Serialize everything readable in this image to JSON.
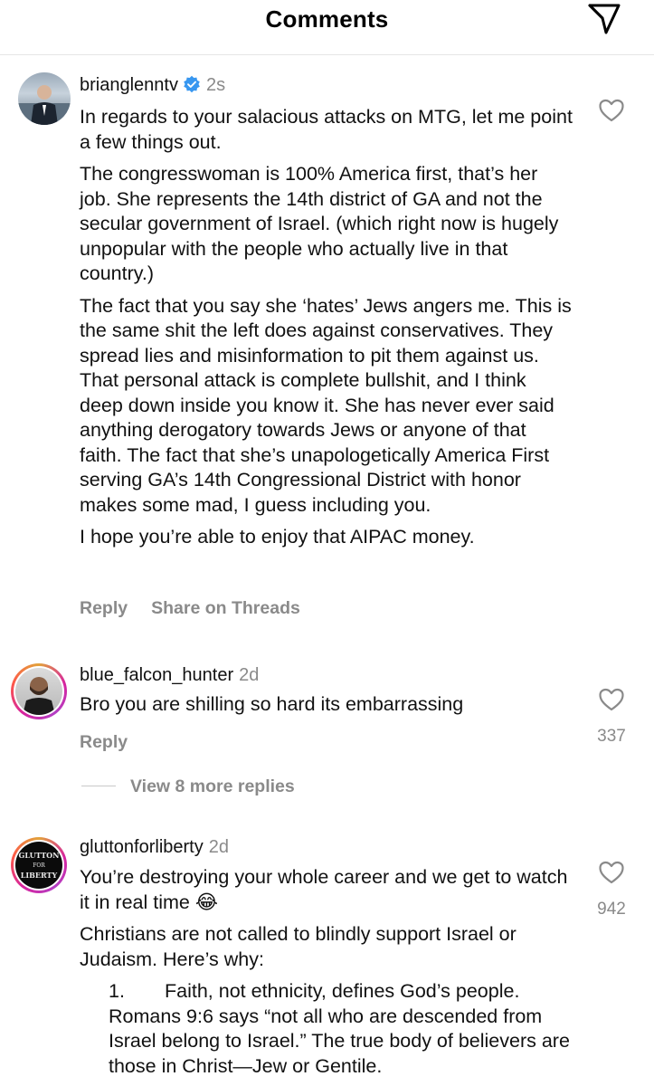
{
  "header": {
    "title": "Comments",
    "send_icon": "send-paper-plane-icon"
  },
  "colors": {
    "secondary_text": "#8a8a8a",
    "verified_blue": "#3897f0",
    "ring_gradient": [
      "#e2a23a",
      "#d6249f",
      "#b33fc4"
    ]
  },
  "comments": [
    {
      "username": "brianglenntv",
      "verified": true,
      "time": "2s",
      "paragraphs": [
        "In regards to your salacious attacks on MTG, let me point a few things out.",
        "The congresswoman is 100% America first, that’s her job. She represents the 14th district of GA and not the secular government of Israel. (which right now is hugely unpopular with the people who actually live in that country.)",
        "The fact that you say she ‘hates’ Jews angers me.  This is the same shit the left does against conservatives. They spread lies and misinformation to pit them against us. That personal attack is complete bullshit, and I think deep down inside you know it. She has never ever said anything derogatory towards Jews or anyone of that faith. The fact that she’s unapologetically America First serving GA’s 14th Congressional District with honor makes some mad, I guess including you.",
        "I hope you’re able to enjoy that AIPAC money."
      ],
      "actions": {
        "reply": "Reply",
        "share": "Share on Threads"
      }
    },
    {
      "username": "blue_falcon_hunter",
      "time": "2d",
      "text": "Bro you are shilling so hard its embarrassing",
      "likes": "337",
      "actions": {
        "reply": "Reply"
      },
      "view_replies": "View 8 more replies"
    },
    {
      "username": "gluttonforliberty",
      "avatar_text": [
        "GLUTTON",
        "FOR",
        "LIBERTY"
      ],
      "time": "2d",
      "text": "You’re destroying your whole career and we get to watch it in real time 😂",
      "paragraph2": "Christians are not called to blindly support Israel or Judaism. Here’s why:",
      "list_number": "1.",
      "list_text": "Faith, not ethnicity, defines God’s people. Romans 9:6 says “not all who are descended from Israel belong to Israel.” The true body of believers are those in Christ—Jew or Gentile.",
      "likes": "942"
    }
  ]
}
